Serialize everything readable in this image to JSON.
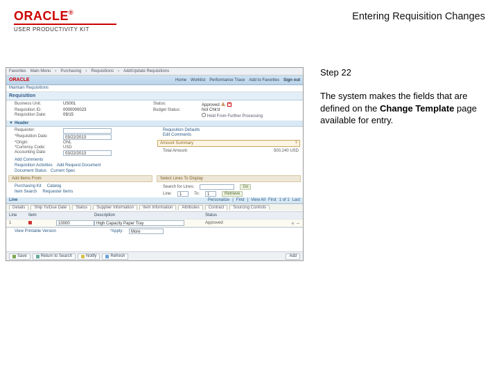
{
  "header": {
    "brand": "ORACLE",
    "reg": "®",
    "upk": "USER PRODUCTIVITY KIT",
    "doc_title": "Entering Requisition Changes"
  },
  "instruction": {
    "step_label": "Step 22",
    "text_before": "The system makes the fields that are defined on the ",
    "bold": "Change Template",
    "text_after": " page available for entry."
  },
  "shot": {
    "top_tabs": [
      "Favorites",
      "Main Menu",
      "Purchasing",
      "Requisitions",
      "Add/Update Requisitions"
    ],
    "nav": [
      "Home",
      "Worklist",
      "Performance Trace",
      "Add to Favorites",
      "Sign out"
    ],
    "breadcrumb": "Maintain Requisitions",
    "page_title": "Requisition",
    "head_fields": {
      "bu_l": "Business Unit:",
      "bu_v": "US001",
      "stat_l": "Status:",
      "stat_v": "Approved",
      "req_l": "Requisition ID:",
      "req_v": "0000000023",
      "date_l": "Requisition Date:",
      "date_v": "09/15",
      "bs_l": "Budget Status:",
      "bs_v": "Not Chk'd",
      "hold_l": "Hold From Further Processing"
    },
    "header_sec": "Header",
    "header_fields": {
      "reqn_l": "Requester:",
      "reqn_v": "",
      "reqd_l": "*Requisition Date:",
      "reqd_v": "03/22/2013",
      "reqdef": "Requisition Defaults",
      "origin_l": "*Origin:",
      "origin_v": "ONL",
      "edit": "Edit Comments",
      "curr_l": "*Currency Code:",
      "curr_v": "USD",
      "amtsum": "Amount Summary",
      "acct_l": "Accounting Date:",
      "acct_v": "03/22/2013"
    },
    "amt_tot_l": "Total Amount:",
    "amt_tot_v": "500.240 USD",
    "extra_links": [
      "Add Comments",
      "Requisition Activities",
      "Document Status",
      "Add Request Document",
      "Current Spec"
    ],
    "add_items": "Add Items From",
    "add_links": [
      "Purchasing Kit",
      "Catalog",
      "Item Search",
      "Requester Items"
    ],
    "select_lines": "Select Lines To Display",
    "search_l": "Search for Lines:",
    "search_go": "Go",
    "line_l": "Line:",
    "line_from": "1",
    "line_to_l": "To:",
    "line_to": "1",
    "retrieve": "Retrieve",
    "line_sec": "Line",
    "grid_tool": [
      "Personalize",
      "Find",
      "View All",
      "First",
      "1 of 1",
      "Last"
    ],
    "tabs": [
      "Details",
      "Ship To/Due Date",
      "Status",
      "Supplier Information",
      "Item Information",
      "Attributes",
      "Contract",
      "Sourcing Controls"
    ],
    "grid_hdr": [
      "Line",
      "Item",
      "Description",
      "",
      "Status",
      ""
    ],
    "grid_row": {
      "line": "1",
      "item": "10000",
      "desc": "High Capacity Paper Tray",
      "status": "Approved"
    },
    "view_printable": "View Printable Version",
    "apply_l": "*Apply:",
    "apply_v": "More",
    "footer": [
      "Save",
      "Return to Search",
      "Notify",
      "Refresh"
    ],
    "footer_right": "Add"
  }
}
